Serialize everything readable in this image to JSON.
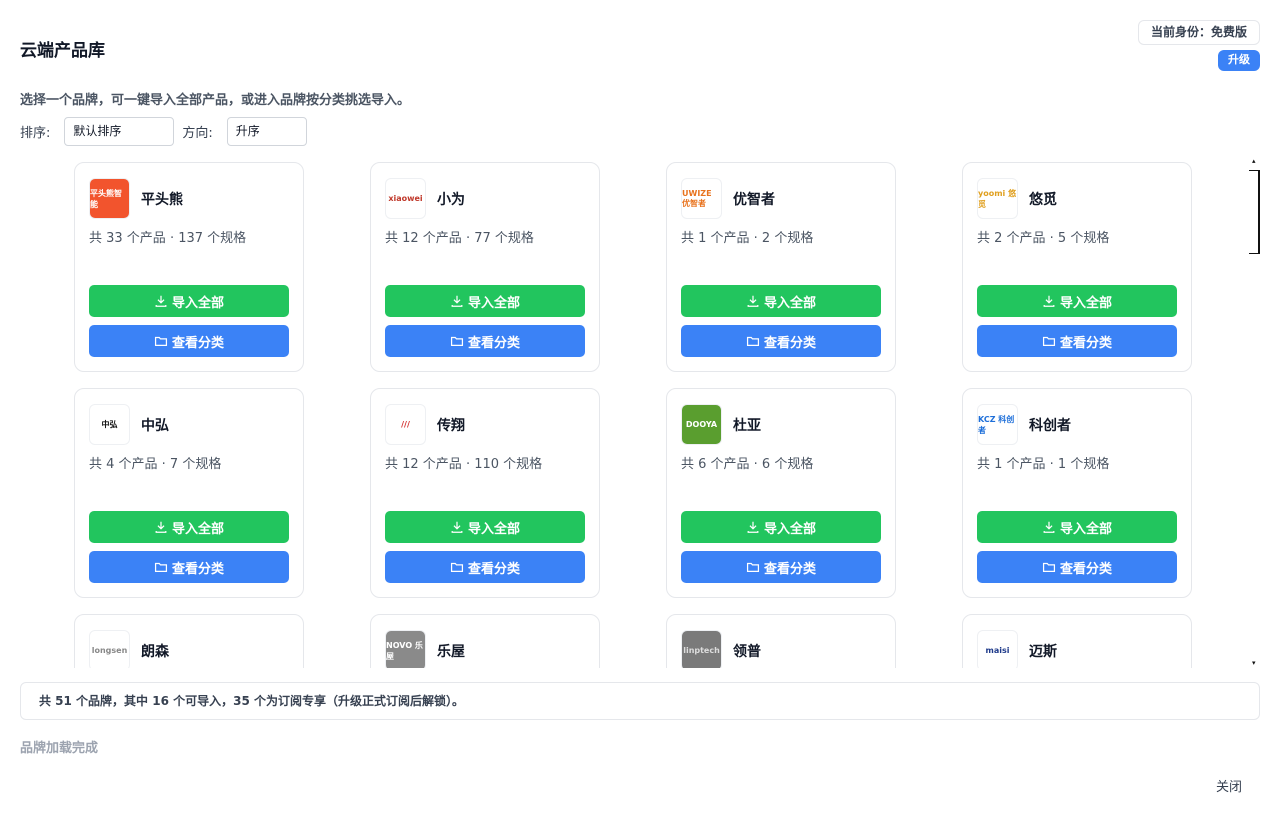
{
  "header": {
    "title": "云端产品库",
    "identity": "当前身份：免费版",
    "upgrade": "升级"
  },
  "subtitle": "选择一个品牌，可一键导入全部产品，或进入品牌按分类挑选导入。",
  "sort": {
    "sort_label": "排序:",
    "sort_value": "默认排序",
    "dir_label": "方向:",
    "dir_value": "升序"
  },
  "buttons": {
    "import_all": "导入全部",
    "view_categories": "查看分类"
  },
  "brands": [
    {
      "name": "平头熊",
      "stats": "共 33 个产品 · 137 个规格",
      "logo_text": "平头熊智能",
      "logo_bg": "#f2542d",
      "logo_fg": "#ffffff"
    },
    {
      "name": "小为",
      "stats": "共 12 个产品 · 77 个规格",
      "logo_text": "xiaowei",
      "logo_bg": "#ffffff",
      "logo_fg": "#c0392b"
    },
    {
      "name": "优智者",
      "stats": "共 1 个产品 · 2 个规格",
      "logo_text": "UWIZE 优智者",
      "logo_bg": "#ffffff",
      "logo_fg": "#e8731e"
    },
    {
      "name": "悠觅",
      "stats": "共 2 个产品 · 5 个规格",
      "logo_text": "yoomi 悠觅",
      "logo_bg": "#ffffff",
      "logo_fg": "#e0a020"
    },
    {
      "name": "中弘",
      "stats": "共 4 个产品 · 7 个规格",
      "logo_text": "中弘",
      "logo_bg": "#ffffff",
      "logo_fg": "#111111"
    },
    {
      "name": "传翔",
      "stats": "共 12 个产品 · 110 个规格",
      "logo_text": "///",
      "logo_bg": "#ffffff",
      "logo_fg": "#d32f2f"
    },
    {
      "name": "杜亚",
      "stats": "共 6 个产品 · 6 个规格",
      "logo_text": "DOOYA",
      "logo_bg": "#5a9e2f",
      "logo_fg": "#ffffff"
    },
    {
      "name": "科创者",
      "stats": "共 1 个产品 · 1 个规格",
      "logo_text": "KCZ 科创者",
      "logo_bg": "#ffffff",
      "logo_fg": "#1e6fd9"
    },
    {
      "name": "朗森",
      "stats": "",
      "logo_text": "longsen",
      "logo_bg": "#ffffff",
      "logo_fg": "#888888"
    },
    {
      "name": "乐屋",
      "stats": "",
      "logo_text": "NOVO 乐屋",
      "logo_bg": "#8a8a8a",
      "logo_fg": "#ffffff"
    },
    {
      "name": "领普",
      "stats": "",
      "logo_text": "linptech",
      "logo_bg": "#7a7a7a",
      "logo_fg": "#dddddd"
    },
    {
      "name": "迈斯",
      "stats": "",
      "logo_text": "maisi",
      "logo_bg": "#ffffff",
      "logo_fg": "#1e3a8a"
    }
  ],
  "summary": "共 51 个品牌，其中 16 个可导入，35 个为订阅专享（升级正式订阅后解锁）。",
  "status": "品牌加载完成",
  "close": "关闭"
}
